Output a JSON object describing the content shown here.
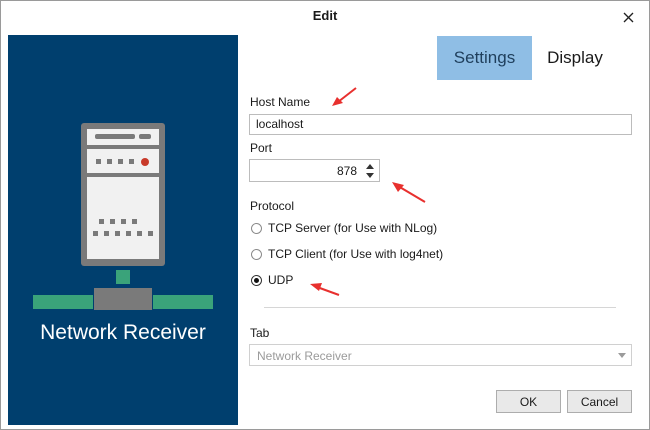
{
  "dialog": {
    "title": "Edit"
  },
  "illustration": {
    "caption": "Network Receiver"
  },
  "tabs": [
    {
      "label": "Settings",
      "active": true
    },
    {
      "label": "Display",
      "active": false
    }
  ],
  "form": {
    "host_name_label": "Host Name",
    "host_name_value": "localhost",
    "port_label": "Port",
    "port_value": "878",
    "protocol_label": "Protocol",
    "protocol_options": [
      {
        "label": "TCP Server (for Use with NLog)",
        "checked": false
      },
      {
        "label": "TCP Client (for Use with log4net)",
        "checked": false
      },
      {
        "label": "UDP",
        "checked": true
      }
    ],
    "tab_label": "Tab",
    "tab_value": "Network Receiver"
  },
  "buttons": {
    "ok": "OK",
    "cancel": "Cancel"
  },
  "colors": {
    "illustration_bg": "#003f6e",
    "active_tab_bg": "#8fbee5",
    "annotation_arrow": "#e8302e"
  }
}
